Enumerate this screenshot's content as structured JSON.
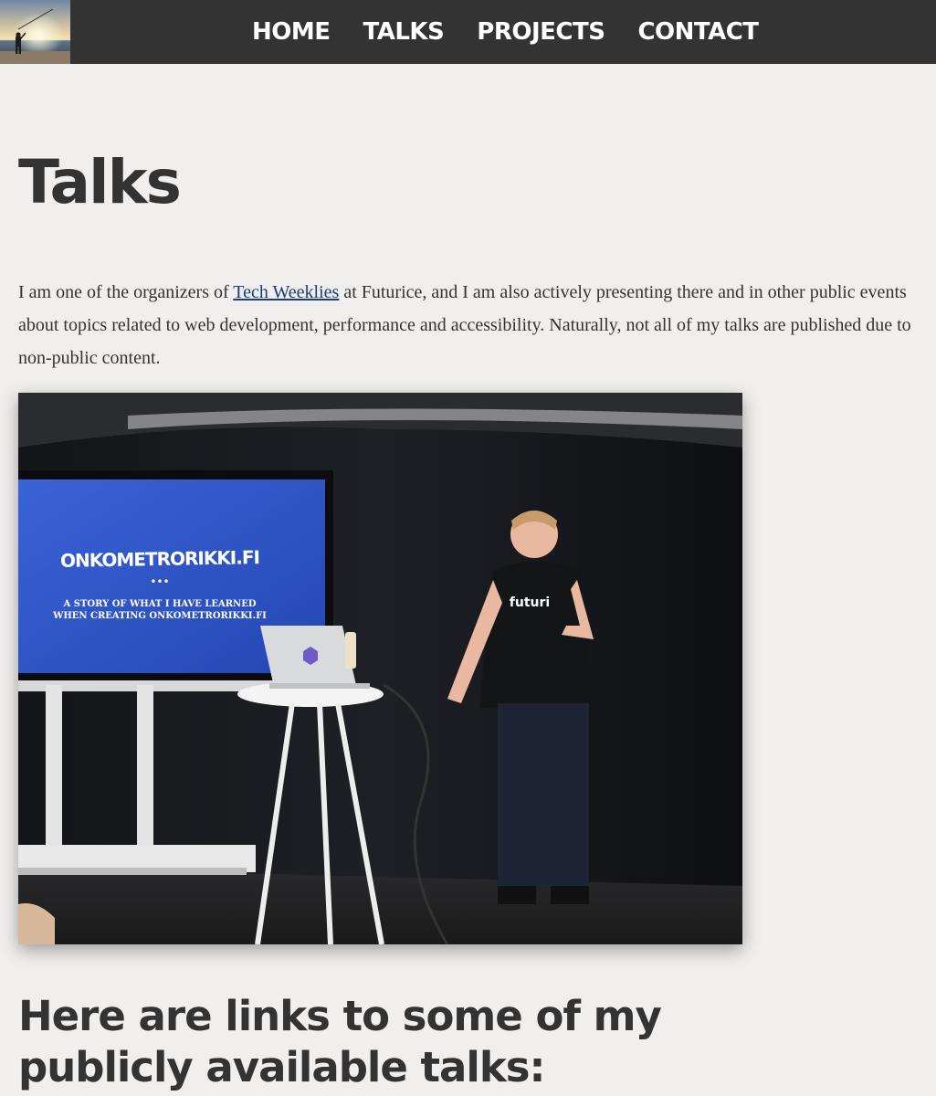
{
  "header": {
    "logo_alt": "",
    "nav": [
      {
        "label": "HOME"
      },
      {
        "label": "TALKS"
      },
      {
        "label": "PROJECTS"
      },
      {
        "label": "CONTACT"
      }
    ]
  },
  "main": {
    "title": "Talks",
    "intro": {
      "before": "I am one of the organizers of ",
      "link_text": "Tech Weeklies",
      "after": " at Futurice, and I am also actively presenting there and in other public events about topics related to web development, performance and accessibility. Naturally, not all of my talks are published due to non-public content."
    },
    "photo": {
      "screen_title": "ONKOMETRORIKKI.FI",
      "screen_dots": "•••",
      "screen_subtitle_1": "A STORY OF WHAT I HAVE LEARNED",
      "screen_subtitle_2": "WHEN CREATING ONKOMETRORIKKI.FI",
      "shirt_text": "futuri"
    },
    "section_title": "Here are links to some of my publicly available talks:"
  },
  "colors": {
    "header_bg": "#333333",
    "page_bg": "#f0efed",
    "text": "#333333",
    "link": "#1a3c78",
    "screen_blue": "#2f56c9"
  }
}
